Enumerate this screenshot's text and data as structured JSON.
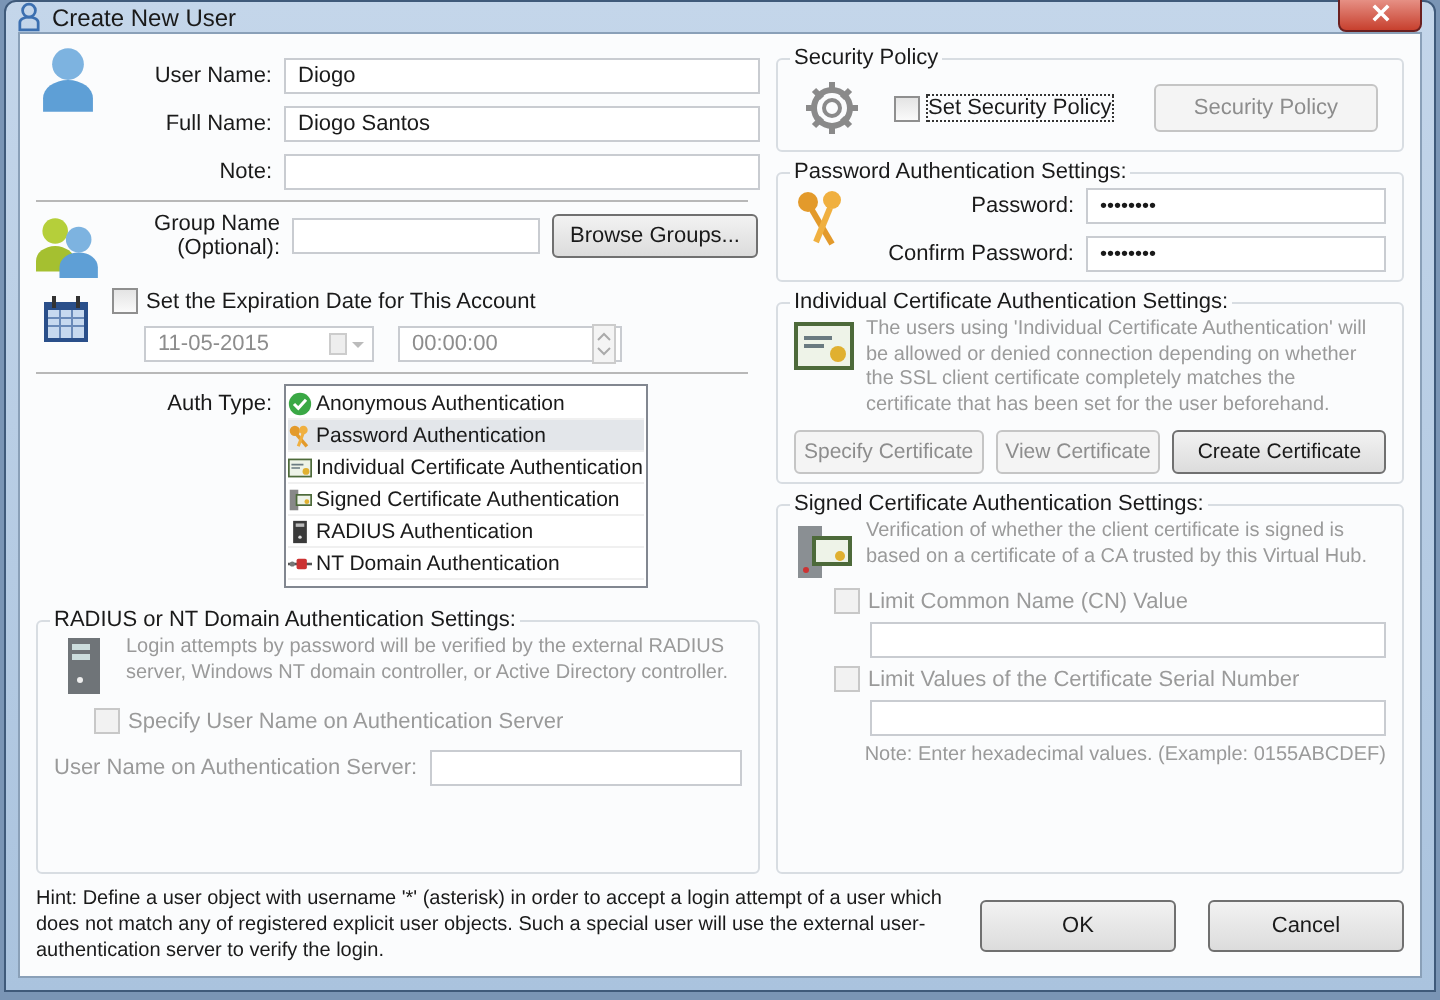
{
  "window": {
    "title": "Create New User"
  },
  "user_fields": [
    {
      "label": "User Name:",
      "value": "Diogo"
    },
    {
      "label": "Full Name:",
      "value": "Diogo Santos"
    },
    {
      "label": "Note:"
    }
  ],
  "group": {
    "label": "Group Name (Optional):",
    "button": "Browse Groups..."
  },
  "expiration": {
    "label": "Set the Expiration Date for This Account",
    "checked": false,
    "date": "11-05-2015",
    "time": "00:00:00"
  },
  "auth_type": {
    "label": "Auth Type:",
    "items": [
      {
        "label": "Anonymous Authentication",
        "kind": "anonymous",
        "selected": false
      },
      {
        "label": "Password Authentication",
        "kind": "password",
        "selected": true
      },
      {
        "label": "Individual Certificate Authentication",
        "kind": "certificate",
        "selected": false
      },
      {
        "label": "Signed Certificate Authentication",
        "kind": "signed",
        "selected": false
      },
      {
        "label": "RADIUS Authentication",
        "kind": "radius",
        "selected": false
      },
      {
        "label": "NT Domain Authentication",
        "kind": "nt",
        "selected": false
      }
    ]
  },
  "radius": {
    "title": "RADIUS or NT Domain Authentication Settings:",
    "disabled": true,
    "description": "Login attempts by password will be verified by the external RADIUS server, Windows NT domain controller, or Active Directory controller.",
    "checkbox": {
      "label": "Specify User Name on Authentication Server",
      "checked": false
    },
    "field_label": "User Name on Authentication Server:"
  },
  "hint": "Hint: Define a user object with username '*' (asterisk) in order to accept a login attempt of a user which does not match any of registered explicit user objects. Such a special user will use the external user-authentication server to verify the login.",
  "security_policy": {
    "title": "Security Policy",
    "checkbox": {
      "label": "Set Security Policy",
      "checked": false
    },
    "button": {
      "label": "Security Policy",
      "disabled": true
    }
  },
  "password": {
    "title": "Password Authentication Settings:",
    "fields": [
      {
        "label": "Password:",
        "value": "••••••••"
      },
      {
        "label": "Confirm Password:",
        "value": "••••••••"
      }
    ]
  },
  "individual_cert": {
    "title": "Individual Certificate Authentication Settings:",
    "disabled": true,
    "description": "The users using 'Individual Certificate Authentication' will be allowed or denied connection depending on whether the SSL client certificate completely matches the certificate that has been set for the user beforehand.",
    "buttons": [
      {
        "label": "Specify Certificate",
        "disabled": true
      },
      {
        "label": "View Certificate",
        "disabled": true
      },
      {
        "label": "Create Certificate",
        "disabled": false
      }
    ]
  },
  "signed_cert": {
    "title": "Signed Certificate Authentication Settings:",
    "disabled": true,
    "description": "Verification of whether the client certificate is signed is based on a certificate of a CA trusted by this Virtual Hub.",
    "options": [
      {
        "label": "Limit Common Name (CN) Value",
        "checked": false
      },
      {
        "label": "Limit Values of the Certificate Serial Number",
        "checked": false
      }
    ],
    "note": "Note: Enter hexadecimal values. (Example: 0155ABCDEF)"
  },
  "buttons": [
    "OK",
    "Cancel"
  ]
}
